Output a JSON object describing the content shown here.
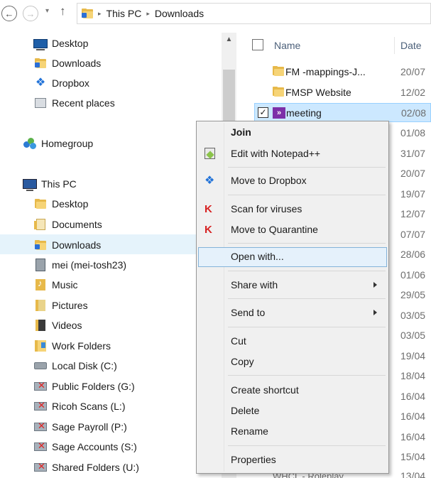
{
  "address_bar": {
    "back_glyph": "←",
    "forward_glyph": "→",
    "dropdown_glyph": "▾",
    "up_glyph": "↑",
    "crumbs": [
      "This PC",
      "Downloads"
    ],
    "crumb_separator": "▸"
  },
  "nav": {
    "items": [
      {
        "label": "Desktop",
        "icon": "desktop-icon"
      },
      {
        "label": "Downloads",
        "icon": "downloads-folder-icon"
      },
      {
        "label": "Dropbox",
        "icon": "dropbox-icon"
      },
      {
        "label": "Recent places",
        "icon": "recent-places-icon"
      },
      {
        "label": "Homegroup",
        "icon": "homegroup-icon"
      },
      {
        "label": "This PC",
        "icon": "computer-icon"
      },
      {
        "label": "Desktop",
        "icon": "desktop-folder-icon"
      },
      {
        "label": "Documents",
        "icon": "documents-folder-icon"
      },
      {
        "label": "Downloads",
        "icon": "downloads-folder-icon"
      },
      {
        "label": "mei (mei-tosh23)",
        "icon": "network-computer-icon"
      },
      {
        "label": "Music",
        "icon": "music-folder-icon"
      },
      {
        "label": "Pictures",
        "icon": "pictures-folder-icon"
      },
      {
        "label": "Videos",
        "icon": "videos-folder-icon"
      },
      {
        "label": "Work Folders",
        "icon": "work-folders-icon"
      },
      {
        "label": "Local Disk (C:)",
        "icon": "local-disk-icon"
      },
      {
        "label": "Public Folders (G:)",
        "icon": "disconnected-drive-icon"
      },
      {
        "label": "Ricoh Scans (L:)",
        "icon": "disconnected-drive-icon"
      },
      {
        "label": "Sage Payroll (P:)",
        "icon": "disconnected-drive-icon"
      },
      {
        "label": "Sage Accounts (S:)",
        "icon": "disconnected-drive-icon"
      },
      {
        "label": "Shared Folders (U:)",
        "icon": "disconnected-drive-icon"
      }
    ],
    "selected_label": "Downloads",
    "scroll_up_glyph": "▲"
  },
  "file_list": {
    "columns": {
      "name": "Name",
      "date": "Date"
    },
    "rows": [
      {
        "name": "FM -mappings-J...",
        "date": "20/07"
      },
      {
        "name": "FMSP Website",
        "date": "12/02"
      },
      {
        "name": "meeting",
        "date": "02/08",
        "selected": true,
        "check_glyph": "✓",
        "icon_glyph": "»"
      }
    ],
    "dates_behind_menu": [
      "01/08",
      "31/07",
      "20/07",
      "19/07",
      "12/07",
      "07/07",
      "28/06",
      "01/06",
      "29/05",
      "03/05",
      "03/05",
      "19/04",
      "18/04",
      "16/04",
      "16/04",
      "16/04",
      "15/04",
      "13/04"
    ],
    "tail_text": "WHCL - Roleplay"
  },
  "context_menu": {
    "items": [
      {
        "label": "Join",
        "bold": true
      },
      {
        "label": "Edit with Notepad++",
        "icon": "notepad-plus-plus-icon"
      },
      {
        "label": "Move to Dropbox",
        "icon": "dropbox-icon"
      },
      {
        "label": "Scan for viruses",
        "icon": "kaspersky-icon",
        "icon_glyph": "K"
      },
      {
        "label": "Move to Quarantine",
        "icon": "kaspersky-icon",
        "icon_glyph": "K"
      },
      {
        "label": "Open with...",
        "hover": true
      },
      {
        "label": "Share with",
        "submenu": true
      },
      {
        "label": "Send to",
        "submenu": true
      },
      {
        "label": "Cut"
      },
      {
        "label": "Copy"
      },
      {
        "label": "Create shortcut"
      },
      {
        "label": "Delete"
      },
      {
        "label": "Rename"
      },
      {
        "label": "Properties"
      }
    ]
  },
  "icons": {
    "dropbox_glyph": "❖"
  }
}
